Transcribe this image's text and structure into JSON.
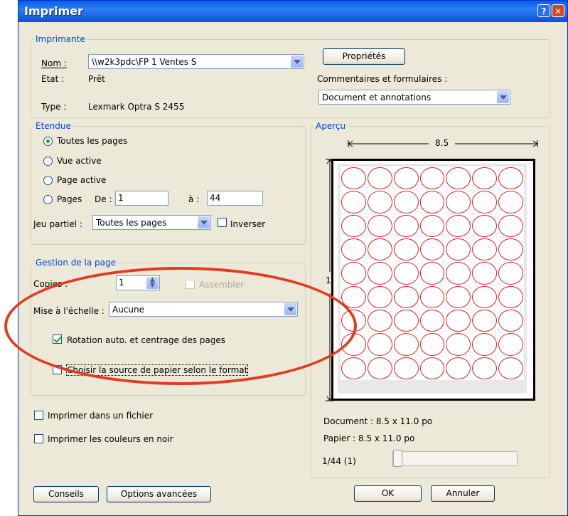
{
  "window": {
    "title": "Imprimer",
    "help_glyph": "?",
    "close_glyph": "✕"
  },
  "printer": {
    "group_label": "Imprimante",
    "name_label": "Nom :",
    "name_value": "\\\\w2k3pdc\\FP 1 Ventes S",
    "state_label": "Etat :",
    "state_value": "Prêt",
    "type_label": "Type :",
    "type_value": "Lexmark Optra S 2455",
    "properties_button": "Propriétés",
    "comments_label": "Commentaires et formulaires :",
    "comments_value": "Document et annotations"
  },
  "range": {
    "group_label": "Etendue",
    "options": [
      "Toutes les pages",
      "Vue active",
      "Page active",
      "Pages"
    ],
    "selected": "Toutes les pages",
    "from_label": "De :",
    "from_value": "1",
    "to_label": "à :",
    "to_value": "44",
    "subset_label": "Jeu partiel :",
    "subset_value": "Toutes les pages",
    "reverse_label": "Inverser"
  },
  "page_handling": {
    "group_label": "Gestion de la page",
    "copies_label": "Copies :",
    "copies_value": "1",
    "collate_label": "Assembler",
    "scale_label": "Mise à l'échelle :",
    "scale_value": "Aucune",
    "auto_rotate_label": "Rotation auto. et centrage des pages",
    "auto_rotate_checked": true,
    "paper_source_label": "Choisir la source de papier selon le format",
    "paper_source_checked": false
  },
  "output": {
    "print_to_file_label": "Imprimer dans un fichier",
    "print_black_label": "Imprimer les couleurs en noir"
  },
  "preview": {
    "group_label": "Aperçu",
    "width_label": "8.5",
    "height_label": "11",
    "document_info": "Document : 8.5 x 11.0 po",
    "paper_info": "Papier : 8.5 x 11.0 po",
    "page_counter": "1/44 (1)",
    "label_columns": 7,
    "label_rows": 9
  },
  "buttons": {
    "tips": "Conseils",
    "advanced": "Options avancées",
    "ok": "OK",
    "cancel": "Annuler"
  },
  "colors": {
    "annotation_ellipse": "#e23b20",
    "label_circles": "#dd2222",
    "group_label": "#0046d5"
  }
}
